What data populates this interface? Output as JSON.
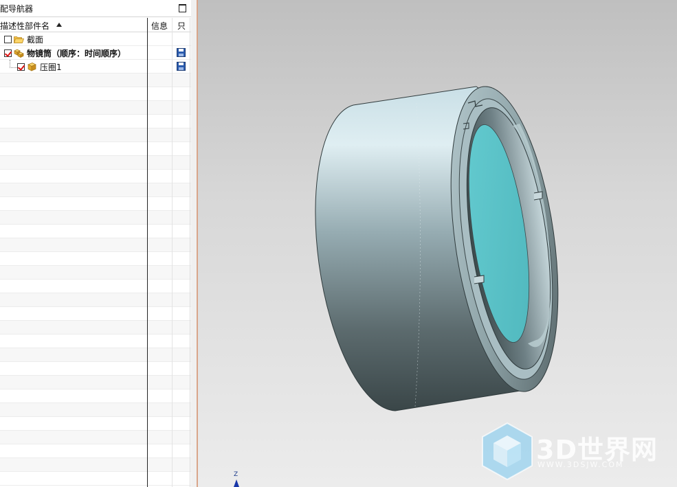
{
  "navigator": {
    "title": "配导航器",
    "columns": {
      "name": "描述性部件名",
      "info": "信息",
      "readonly": "只"
    },
    "nodes": [
      {
        "label": "截面",
        "checked": false,
        "icon": "folder-icon",
        "bold": false
      },
      {
        "label": "物镜筒（顺序：时间顺序）",
        "checked": true,
        "icon": "assembly-icon",
        "bold": true,
        "saved": true
      },
      {
        "label": "压圈1",
        "checked": true,
        "icon": "part-icon",
        "bold": false,
        "saved": true
      }
    ]
  },
  "viewport": {
    "watermark_text": "3D世界网",
    "watermark_url": "WWW.3DSJW.COM",
    "triad_axis_label": "Z",
    "colors": {
      "background_top": "#bfbfbf",
      "background_bottom": "#ececec",
      "lens_glass": "#5cc4c8",
      "barrel_light": "#d6e8ee",
      "barrel_dark": "#3e4a4c"
    }
  }
}
